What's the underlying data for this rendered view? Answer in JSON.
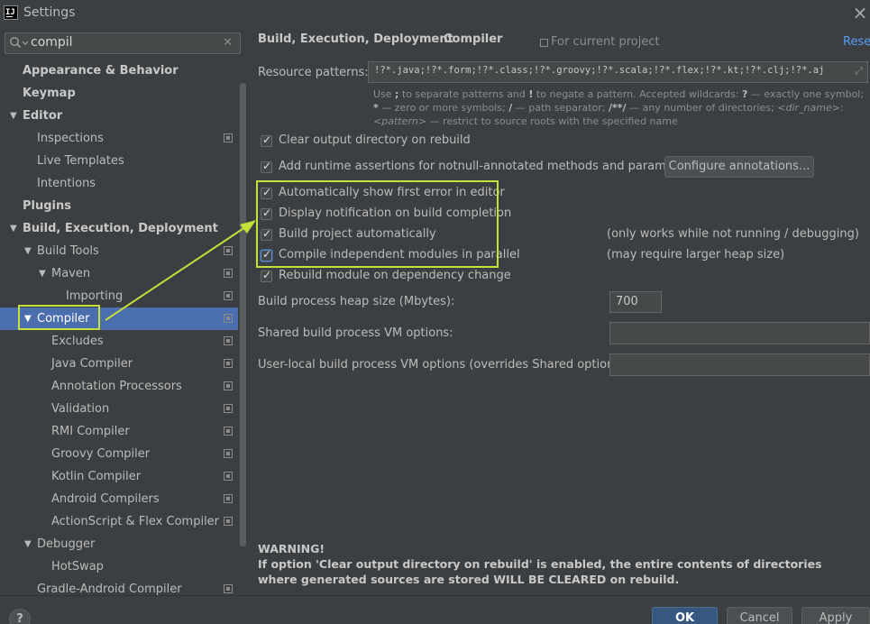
{
  "window": {
    "title": "Settings"
  },
  "search": {
    "value": "compil"
  },
  "tree": [
    {
      "label": "Appearance & Behavior",
      "level": 0,
      "bold": true,
      "arrow": ""
    },
    {
      "label": "Keymap",
      "level": 0,
      "bold": true,
      "arrow": ""
    },
    {
      "label": "Editor",
      "level": 0,
      "bold": true,
      "arrow": "down"
    },
    {
      "label": "Inspections",
      "level": 1,
      "proj": true
    },
    {
      "label": "Live Templates",
      "level": 1
    },
    {
      "label": "Intentions",
      "level": 1
    },
    {
      "label": "Plugins",
      "level": 0,
      "bold": true
    },
    {
      "label": "Build, Execution, Deployment",
      "level": 0,
      "bold": true,
      "arrow": "down"
    },
    {
      "label": "Build Tools",
      "level": 1,
      "arrow": "down",
      "proj": true
    },
    {
      "label": "Maven",
      "level": 2,
      "arrow": "down",
      "proj": true
    },
    {
      "label": "Importing",
      "level": 3,
      "proj": true
    },
    {
      "label": "Compiler",
      "level": 1,
      "arrow": "down",
      "proj": true,
      "selected": true
    },
    {
      "label": "Excludes",
      "level": 2,
      "proj": true
    },
    {
      "label": "Java Compiler",
      "level": 2,
      "proj": true
    },
    {
      "label": "Annotation Processors",
      "level": 2,
      "proj": true
    },
    {
      "label": "Validation",
      "level": 2,
      "proj": true
    },
    {
      "label": "RMI Compiler",
      "level": 2,
      "proj": true
    },
    {
      "label": "Groovy Compiler",
      "level": 2,
      "proj": true
    },
    {
      "label": "Kotlin Compiler",
      "level": 2,
      "proj": true
    },
    {
      "label": "Android Compilers",
      "level": 2,
      "proj": true
    },
    {
      "label": "ActionScript & Flex Compiler",
      "level": 2,
      "proj": true
    },
    {
      "label": "Debugger",
      "level": 1,
      "arrow": "down"
    },
    {
      "label": "HotSwap",
      "level": 2
    },
    {
      "label": "Gradle-Android Compiler",
      "level": 1,
      "proj": true
    }
  ],
  "breadcrumb": {
    "part1": "Build, Execution, Deployment",
    "sep": "›",
    "part2": "Compiler",
    "scope": "For current project",
    "reset": "Reset"
  },
  "resource": {
    "label": "Resource patterns:",
    "value": "!?*.java;!?*.form;!?*.class;!?*.groovy;!?*.scala;!?*.flex;!?*.kt;!?*.clj;!?*.aj",
    "hint_html": "Use <b>;</b> to separate patterns and <b>!</b> to negate a pattern. Accepted wildcards: <b>?</b> — exactly one symbol; <b>*</b> — zero or more symbols; <b>/</b> — path separator; <b>/**/</b> — any number of directories; <i>&lt;dir_name&gt;</i>:<i>&lt;pattern&gt;</i> — restrict to source roots with the specified name"
  },
  "options": {
    "clear_output": "Clear output directory on rebuild",
    "runtime_assertions": "Add runtime assertions for notnull-annotated methods and parameters",
    "configure_annotations": "Configure annotations...",
    "show_first_error": "Automatically show first error in editor",
    "display_notification": "Display notification on build completion",
    "build_auto": "Build project automatically",
    "build_auto_note": "(only works while not running / debugging)",
    "compile_parallel": "Compile independent modules in parallel",
    "compile_parallel_note": "(may require larger heap size)",
    "rebuild_module": "Rebuild module on dependency change"
  },
  "heap": {
    "label": "Build process heap size (Mbytes):",
    "value": "700"
  },
  "shared_vm": {
    "label": "Shared build process VM options:",
    "value": ""
  },
  "user_vm": {
    "label": "User-local build process VM options (overrides Shared options):",
    "value": ""
  },
  "warning": {
    "title": "WARNING!",
    "text": "If option 'Clear output directory on rebuild' is enabled, the entire contents of directories where generated sources are stored WILL BE CLEARED on rebuild."
  },
  "buttons": {
    "help": "?",
    "ok": "OK",
    "cancel": "Cancel",
    "apply": "Apply"
  },
  "colors": {
    "accent": "#4b6eaf",
    "highlight": "#c4e03a",
    "link": "#589df6"
  }
}
